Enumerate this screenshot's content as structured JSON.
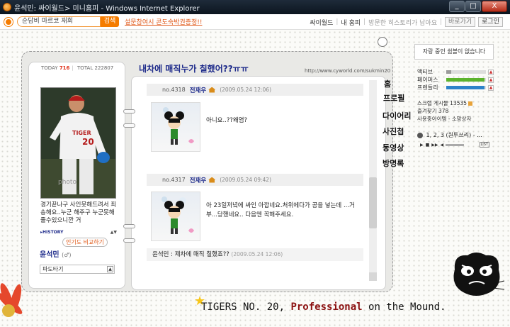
{
  "window": {
    "title": "윤석민: 싸이월드> 미니홈피 - Windows Internet Explorer",
    "minimize": "_",
    "maximize": "□",
    "close": "X"
  },
  "cyworld_bar": {
    "search_value": "순담비 마르코 재회",
    "search_button": "검색",
    "promo_link": "설문참여시 콘도숙박권증정!!",
    "links": [
      "싸이월드",
      "내 홈피"
    ],
    "visited": "방문한 히스토리가 남아요",
    "goto": "바로가기",
    "login": "로그인"
  },
  "home": {
    "today_label": "TODAY",
    "today_value": "716",
    "total_label": "TOTAL",
    "total_value": "222807",
    "title": "내차에 매직누가 칠했어??ㅠㅠ",
    "url": "http://www.cyworld.com/sukmin20"
  },
  "profile": {
    "text": "경기끝나구 사인못해드려서 죄송해요..누군 해주구 누군못해줄수있으니깐 거",
    "history_label": "HISTORY",
    "popularity_button": "인기도 비교하기",
    "owner_name": "윤석민",
    "owner_gender": "(♂)",
    "wave_select": "파도타기"
  },
  "guestbook": [
    {
      "no": "no.4318",
      "author": "전재우",
      "date": "(2009.05.24 12:06)",
      "message": "아니요..??왜염?"
    },
    {
      "no": "no.4317",
      "author": "전재우",
      "date": "(2009.05.24 09:42)",
      "message": "아 23일저녘에 싸인 아깝네요.처위에다가 공을 넣는데 ...거부...당했네요.. 다음엔 꼭해주세요."
    }
  ],
  "reply": {
    "name": "윤석민 : 제차에 매직 칠했죠??",
    "date": "(2009.05.24 12:06)"
  },
  "menu_tabs": [
    "홈",
    "프로필",
    "다이어리",
    "사진첩",
    "동영상",
    "방명록"
  ],
  "side_panel": {
    "notice": "자랑 중인 쉼볼이 없습니다",
    "stats": [
      {
        "label": "액티브",
        "value": 0.12,
        "color": "#9a9a9a"
      },
      {
        "label": "페이머스",
        "value": 0.96,
        "color": "#5cb32d"
      },
      {
        "label": "프렌들리",
        "value": 0.96,
        "color": "#2d83c9"
      }
    ],
    "scrap": "스크랩 게시물 13535",
    "favorites": "즐겨찾기 378",
    "items": "사용중아이템 - 소망상자",
    "player_track": "1, 2, 3 (원투쓰리) - ...",
    "player_list": "LIST"
  },
  "caption": {
    "prefix": "TIGERS NO. 20, ",
    "highlight": "Professional",
    "suffix": " on the Mound."
  }
}
